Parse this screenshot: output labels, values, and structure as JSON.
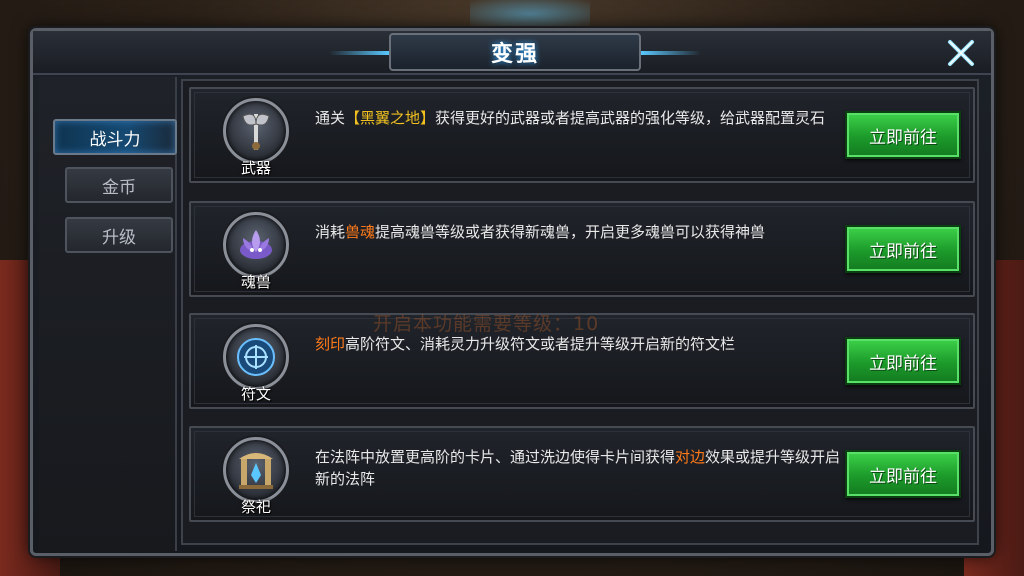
{
  "window": {
    "title": "变强"
  },
  "sidebar": {
    "tabs": [
      {
        "label": "战斗力",
        "active": true
      },
      {
        "label": "金币",
        "active": false
      },
      {
        "label": "升级",
        "active": false
      }
    ]
  },
  "items": [
    {
      "icon_label": "武器",
      "icon": "axe-icon",
      "desc_before": "通关",
      "desc_hl": "【黑翼之地】",
      "desc_hl_color": "#f0c020",
      "desc_after": "获得更好的武器或者提高武器的强化等级，给武器配置灵石",
      "button": "立即前往"
    },
    {
      "icon_label": "魂兽",
      "icon": "lotus-beast-icon",
      "desc_before": "消耗",
      "desc_hl": "兽魂",
      "desc_hl_color": "#ff7a1a",
      "desc_after": "提高魂兽等级或者获得新魂兽，开启更多魂兽可以获得神兽",
      "button": "立即前往"
    },
    {
      "icon_label": "符文",
      "icon": "rune-icon",
      "desc_before": "",
      "desc_hl": "刻印",
      "desc_hl_color": "#ff7a1a",
      "desc_after": "高阶符文、消耗灵力升级符文或者提升等级开启新的符文栏",
      "button": "立即前往"
    },
    {
      "icon_label": "祭祀",
      "icon": "altar-icon",
      "desc_before": "在法阵中放置更高阶的卡片、通过洗边使得卡片间获得",
      "desc_hl": "对边",
      "desc_hl_color": "#ff7a1a",
      "desc_after": "效果或提升等级开启新的法阵",
      "button": "立即前往"
    }
  ],
  "overlay": {
    "text": "开启本功能需要等级：10"
  },
  "colors": {
    "button_green": "#1c9a2a",
    "title_glow": "#3aa8ff",
    "highlight_yellow": "#f0c020",
    "highlight_orange": "#ff7a1a"
  }
}
